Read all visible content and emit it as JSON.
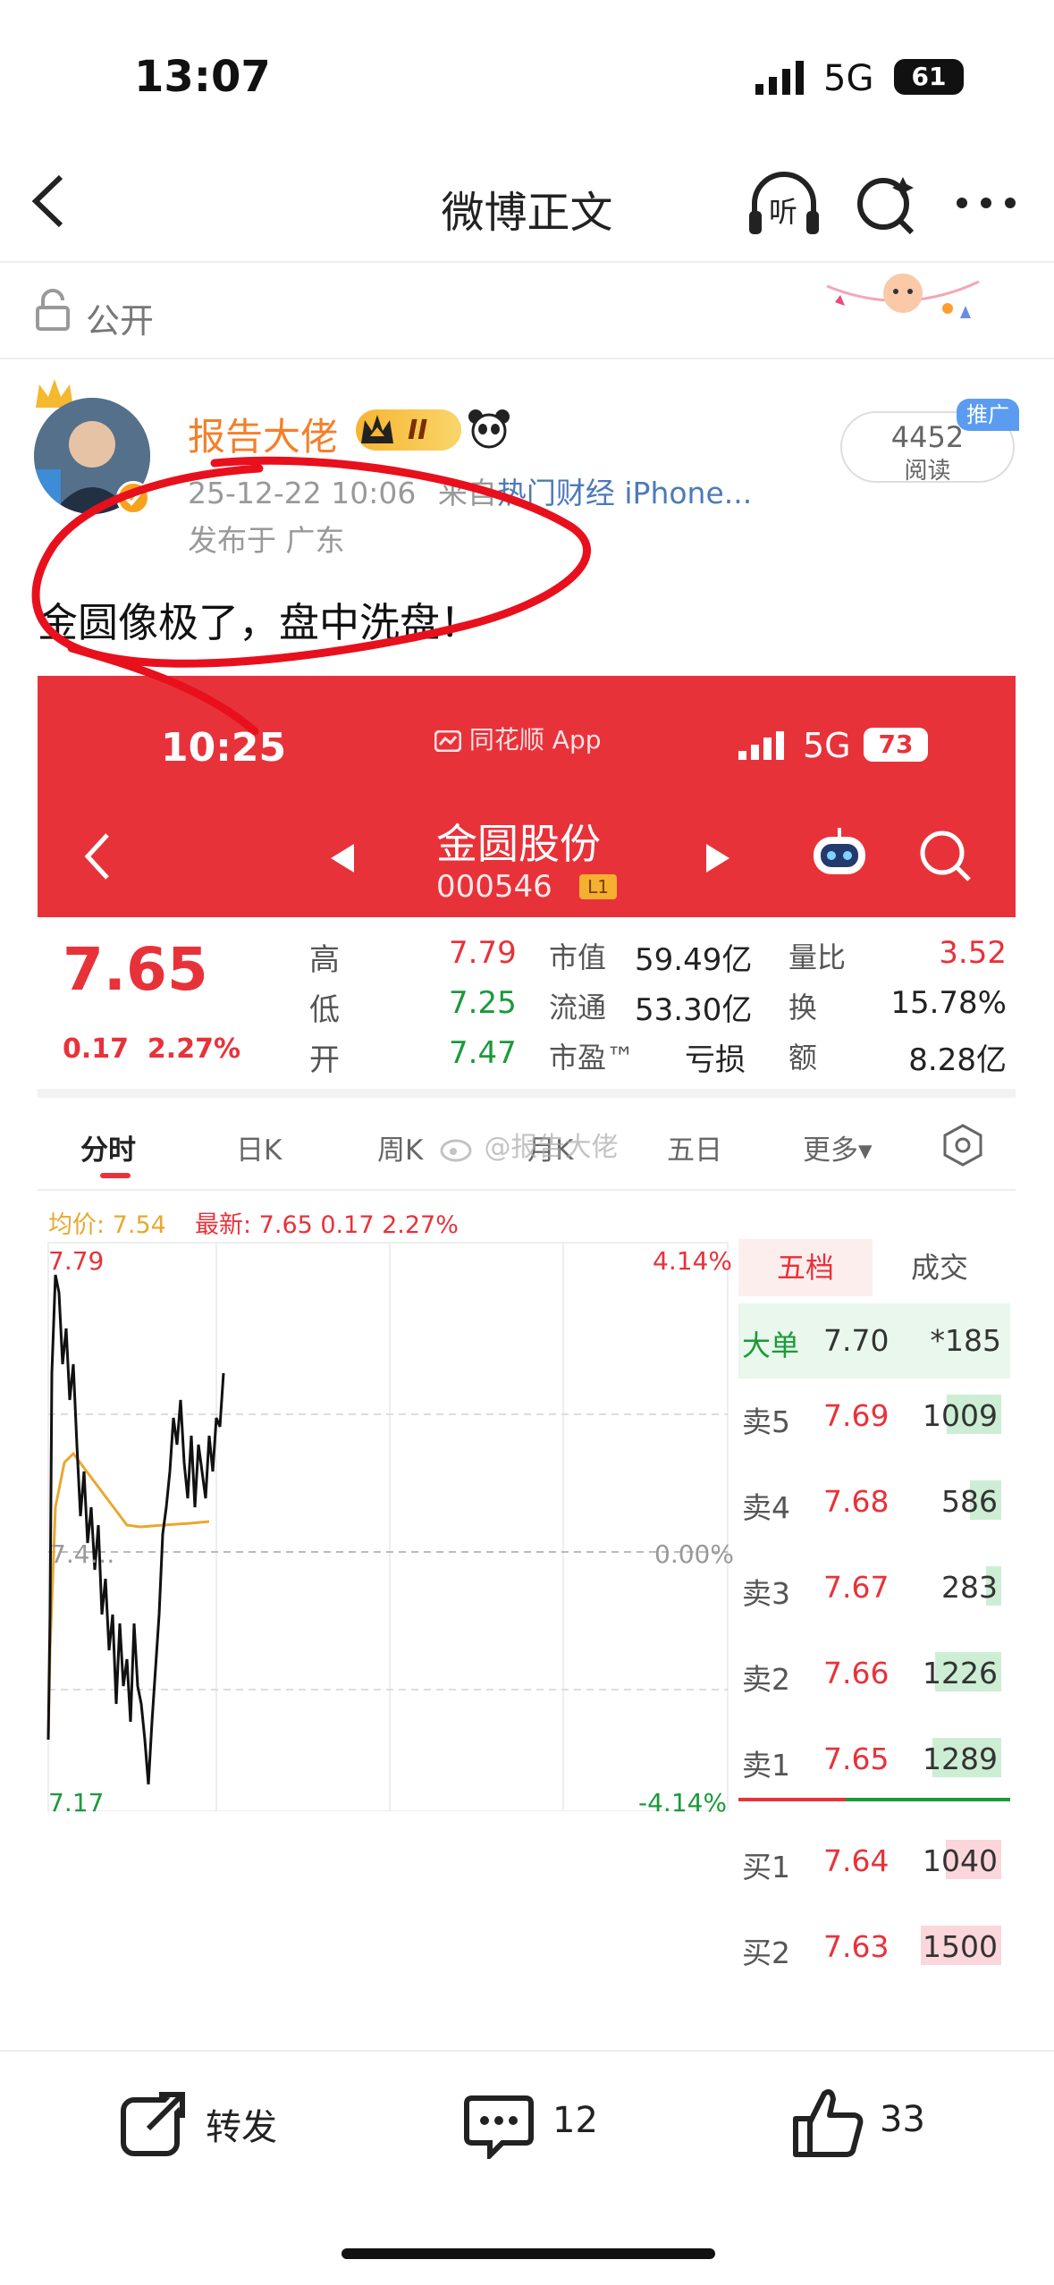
{
  "status_bar": {
    "time": "13:07",
    "network": "5G",
    "battery": "61"
  },
  "nav": {
    "title": "微博正文",
    "listen_label": "听"
  },
  "visibility": {
    "label": "公开"
  },
  "post": {
    "username": "报告大佬",
    "level_badge": "II",
    "timestamp": "25-12-22 10:06",
    "source_prefix": "来自",
    "source": "热门财经 iPhone...",
    "location": "发布于 广东",
    "text": "金圆像极了，盘中洗盘！",
    "read_count": "4452",
    "read_label": "阅读",
    "promo_badge": "推广"
  },
  "screenshot": {
    "time": "10:25",
    "app_name": "同花顺 App",
    "network": "5G",
    "battery": "73",
    "stock_name": "金圆股份",
    "stock_code": "000546",
    "code_badge": "L1",
    "price": "7.65",
    "change": "0.17",
    "change_pct": "2.27%",
    "quote": {
      "high_label": "高",
      "high": "7.79",
      "low_label": "低",
      "low": "7.25",
      "open_label": "开",
      "open": "7.47",
      "mktcap_label": "市值",
      "mktcap": "59.49亿",
      "float_label": "流通",
      "float": "53.30亿",
      "pe_label": "市盈™",
      "pe": "亏损",
      "volratio_label": "量比",
      "volratio": "3.52",
      "turnover_label": "换",
      "turnover": "15.78%",
      "amount_label": "额",
      "amount": "8.28亿"
    },
    "tabs": [
      "分时",
      "日K",
      "周K",
      "月K",
      "五日",
      "更多▾"
    ],
    "watermark": "@报告大佬",
    "avg_line": "均价: 7.54",
    "latest_line": "最新: 7.65  0.17  2.27%",
    "chart_labels": {
      "max": "7.79",
      "min": "7.17",
      "mid": "7.4…",
      "pct_max": "4.14%",
      "pct_zero": "0.00%",
      "pct_min": "-4.14%"
    },
    "orderbook_tabs": [
      "五档",
      "成交"
    ],
    "big_order": {
      "label": "大单",
      "price": "7.70",
      "vol": "*185"
    },
    "orderbook": [
      {
        "label": "卖5",
        "price": "7.69",
        "vol": "1009",
        "side": "sell"
      },
      {
        "label": "卖4",
        "price": "7.68",
        "vol": "586",
        "side": "sell"
      },
      {
        "label": "卖3",
        "price": "7.67",
        "vol": "283",
        "side": "sell"
      },
      {
        "label": "卖2",
        "price": "7.66",
        "vol": "1226",
        "side": "sell"
      },
      {
        "label": "卖1",
        "price": "7.65",
        "vol": "1289",
        "side": "sell"
      },
      {
        "label": "买1",
        "price": "7.64",
        "vol": "1040",
        "side": "buy"
      },
      {
        "label": "买2",
        "price": "7.63",
        "vol": "1500",
        "side": "buy"
      }
    ]
  },
  "actions": {
    "repost_label": "转发",
    "comment_count": "12",
    "like_count": "33"
  },
  "colors": {
    "accent": "#f47f2a",
    "stock_red": "#e8323a",
    "stock_green": "#1a9a3a",
    "annotation": "#e8101c"
  }
}
